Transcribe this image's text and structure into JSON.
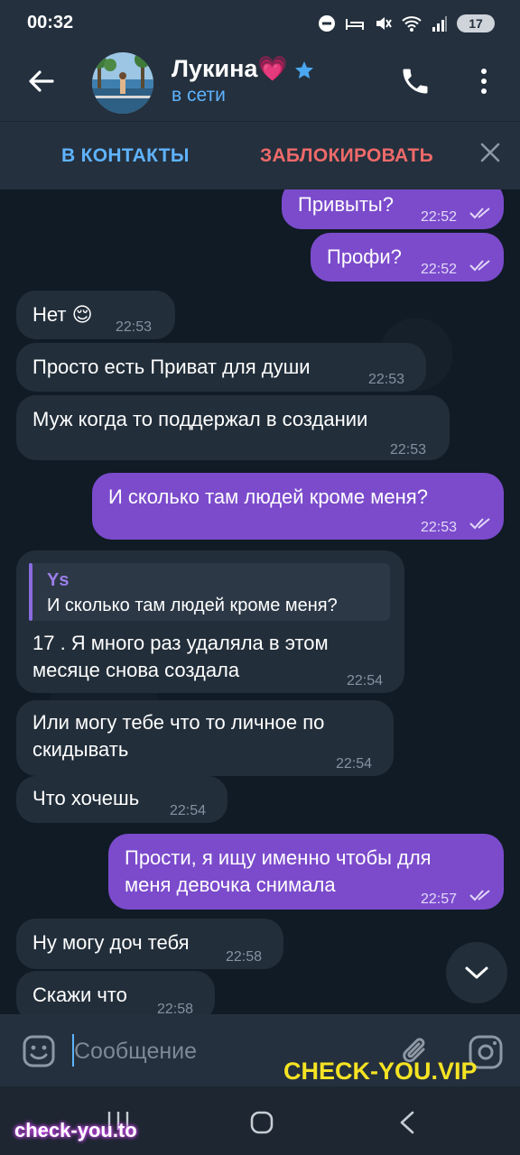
{
  "status_bar": {
    "time": "00:32",
    "battery": "17"
  },
  "header": {
    "contact_name": "Лукина",
    "name_emoji": "💗",
    "status": "в сети",
    "icons": [
      "back-arrow-icon",
      "star-icon",
      "phone-icon",
      "more-vertical-icon"
    ]
  },
  "actions": {
    "add_contact": "В КОНТАКТЫ",
    "block": "ЗАБЛОКИРОВАТЬ",
    "close_icon": "close-icon"
  },
  "messages": [
    {
      "dir": "out",
      "text": "Привыты?",
      "time": "22:52",
      "read": true
    },
    {
      "dir": "out",
      "text": "Профи?",
      "time": "22:52",
      "read": true
    },
    {
      "dir": "in",
      "text": "Нет 😌",
      "time": "22:53"
    },
    {
      "dir": "in",
      "text": "Просто есть Приват для души",
      "time": "22:53"
    },
    {
      "dir": "in",
      "text": "Муж когда то поддержал в создании",
      "time": "22:53"
    },
    {
      "dir": "out",
      "text": "И сколько там людей кроме меня?",
      "time": "22:53",
      "read": true
    },
    {
      "dir": "in",
      "reply_to": {
        "name": "Ys",
        "text": "И сколько там людей кроме меня?"
      },
      "text": "17 . Я много раз удаляла в этом\nмесяце снова создала",
      "time": "22:54"
    },
    {
      "dir": "in",
      "text": "Или могу тебе что то личное по\nскидывать",
      "time": "22:54"
    },
    {
      "dir": "in",
      "text": "Что хочешь",
      "time": "22:54"
    },
    {
      "dir": "out",
      "text": "Прости, я ищу именно чтобы для\nменя девочка снимала",
      "time": "22:57",
      "read": true
    },
    {
      "dir": "in",
      "text": "Ну могу доч тебя",
      "time": "22:58"
    },
    {
      "dir": "in",
      "text": "Скажи что",
      "time": "22:58"
    }
  ],
  "input": {
    "placeholder": "Сообщение"
  },
  "watermarks": {
    "top": "CHECK-YOU.VIP",
    "bottom": "check-you.to"
  },
  "colors": {
    "header_bg": "#24303d",
    "chat_bg": "#101b25",
    "incoming_bubble": "#222e3a",
    "outgoing_bubble": "#7b4bcc",
    "accent_blue": "#5fb3ff",
    "block_red": "#ef6a6a"
  }
}
